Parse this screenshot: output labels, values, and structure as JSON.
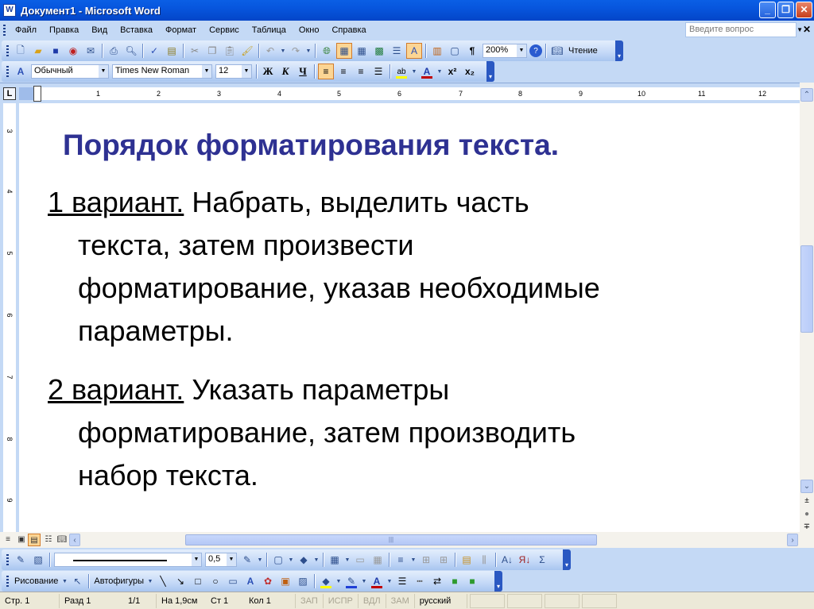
{
  "window": {
    "title": "Документ1 - Microsoft Word",
    "icon": "word-app-icon",
    "controls": {
      "minimize": "_",
      "restore": "❐",
      "close": "✕"
    }
  },
  "menubar": {
    "items": [
      {
        "label": "Файл",
        "accel": "Ф"
      },
      {
        "label": "Правка",
        "accel": "П"
      },
      {
        "label": "Вид",
        "accel": "В"
      },
      {
        "label": "Вставка",
        "accel": "а"
      },
      {
        "label": "Формат",
        "accel": "м"
      },
      {
        "label": "Сервис",
        "accel": "р"
      },
      {
        "label": "Таблица",
        "accel": "Т"
      },
      {
        "label": "Окно",
        "accel": "к"
      },
      {
        "label": "Справка",
        "accel": "С"
      }
    ],
    "help_placeholder": "Введите вопрос",
    "close_glyph": "✕"
  },
  "standard_toolbar": {
    "icons": [
      "new-document-icon",
      "open-folder-icon",
      "save-icon",
      "permission-icon",
      "email-icon",
      "print-icon",
      "print-preview-icon",
      "spelling-icon",
      "research-icon",
      "cut-icon",
      "copy-icon",
      "paste-icon",
      "format-painter-icon",
      "undo-icon",
      "redo-icon",
      "hyperlink-icon",
      "tables-borders-icon",
      "insert-table-icon",
      "insert-excel-icon",
      "columns-icon",
      "drawing-icon",
      "document-map-icon",
      "show-hide-icon",
      "help-icon"
    ],
    "zoom": "200%",
    "reading_label": "Чтение",
    "pilcrow": "¶"
  },
  "formatting_toolbar": {
    "style": "Обычный",
    "font": "Times New Roman",
    "size": "12",
    "bold": "Ж",
    "italic": "К",
    "underline": "Ч",
    "alignment_active": "left",
    "font_color": "#c00000",
    "highlight_color": "#ffff00",
    "superscript": "x²",
    "subscript": "x₂"
  },
  "ruler": {
    "tab_selector": "L",
    "ticks": [
      "1",
      "2",
      "3",
      "4",
      "5",
      "6",
      "7",
      "8",
      "9",
      "10",
      "11",
      "12"
    ],
    "vertical_ticks": [
      "3",
      "4",
      "5",
      "6",
      "7",
      "8",
      "9"
    ]
  },
  "document": {
    "heading": "Порядок форматирования текста.",
    "heading_color": "#2e3192",
    "paragraphs": [
      {
        "lead": "1 вариант.",
        "first": " Набрать, выделить часть",
        "lines": [
          "текста, затем произвести",
          "форматирование, указав необходимые",
          "параметры."
        ]
      },
      {
        "lead": "2 вариант.",
        "first": " Указать параметры",
        "lines": [
          "форматирование, затем производить",
          "набор текста."
        ]
      }
    ]
  },
  "scrollbars": {
    "up": "⌃",
    "down": "⌄",
    "prev_page": "±",
    "browse_object": "●",
    "next_page": "∓",
    "left": "‹",
    "right": "›",
    "grip": "|||"
  },
  "view_buttons": [
    "normal-view",
    "web-layout-view",
    "print-layout-view",
    "outline-view",
    "reading-layout-view"
  ],
  "tables_toolbar": {
    "line_weight": "0,5"
  },
  "drawing_toolbar": {
    "drawing_label": "Рисование",
    "autoshapes_label": "Автофигуры",
    "fill_color": "#ffff00",
    "line_color": "#1f3fd6",
    "font_color": "#c00000"
  },
  "statusbar": {
    "page": "Стр. 1",
    "section": "Разд 1",
    "pages": "1/1",
    "at": "На 1,9см",
    "line": "Ст 1",
    "col": "Кол 1",
    "rec": "ЗАП",
    "trk": "ИСПР",
    "ext": "ВДЛ",
    "ovr": "ЗАМ",
    "language": "русский (Ро"
  }
}
